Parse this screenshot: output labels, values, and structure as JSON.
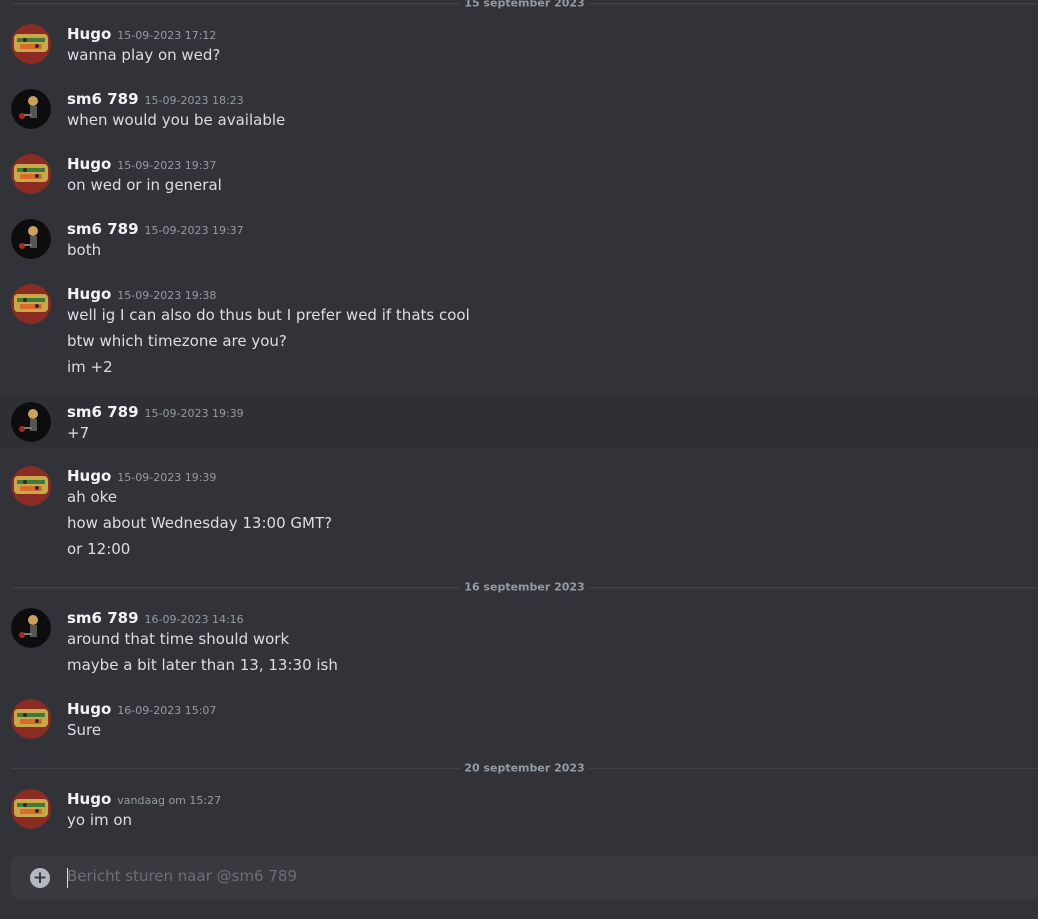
{
  "chat": {
    "dividers": [
      "15 september 2023",
      "16 september 2023",
      "20 september 2023"
    ],
    "messages": [
      {
        "user": "Hugo",
        "time": "15-09-2023 17:12",
        "lines": [
          "wanna play on wed?"
        ]
      },
      {
        "user": "sm6 789",
        "time": "15-09-2023 18:23",
        "lines": [
          "when would you be available"
        ]
      },
      {
        "user": "Hugo",
        "time": "15-09-2023 19:37",
        "lines": [
          "on wed or in general"
        ]
      },
      {
        "user": "sm6 789",
        "time": "15-09-2023 19:37",
        "lines": [
          "both"
        ]
      },
      {
        "user": "Hugo",
        "time": "15-09-2023 19:38",
        "lines": [
          "well ig I can also do thus but I prefer wed if thats cool",
          "btw which timezone are you?",
          "im +2"
        ]
      },
      {
        "user": "sm6 789",
        "time": "15-09-2023 19:39",
        "lines": [
          "+7"
        ]
      },
      {
        "user": "Hugo",
        "time": "15-09-2023 19:39",
        "lines": [
          "ah oke",
          "how about Wednesday 13:00 GMT?",
          "or 12:00"
        ]
      },
      {
        "user": "sm6 789",
        "time": "16-09-2023 14:16",
        "lines": [
          "around that time should work",
          "maybe a bit later than 13, 13:30 ish"
        ]
      },
      {
        "user": "Hugo",
        "time": "16-09-2023 15:07",
        "lines": [
          "Sure"
        ]
      },
      {
        "user": "Hugo",
        "time": "vandaag om 15:27",
        "lines": [
          "yo im on"
        ]
      }
    ]
  },
  "composer": {
    "placeholder": "Bericht sturen naar @sm6 789",
    "add_icon": "plus-circle-icon"
  },
  "colors": {
    "background": "#313338",
    "composer": "#383a40",
    "username": "#f2f3f5",
    "timestamp": "#949ba4"
  }
}
